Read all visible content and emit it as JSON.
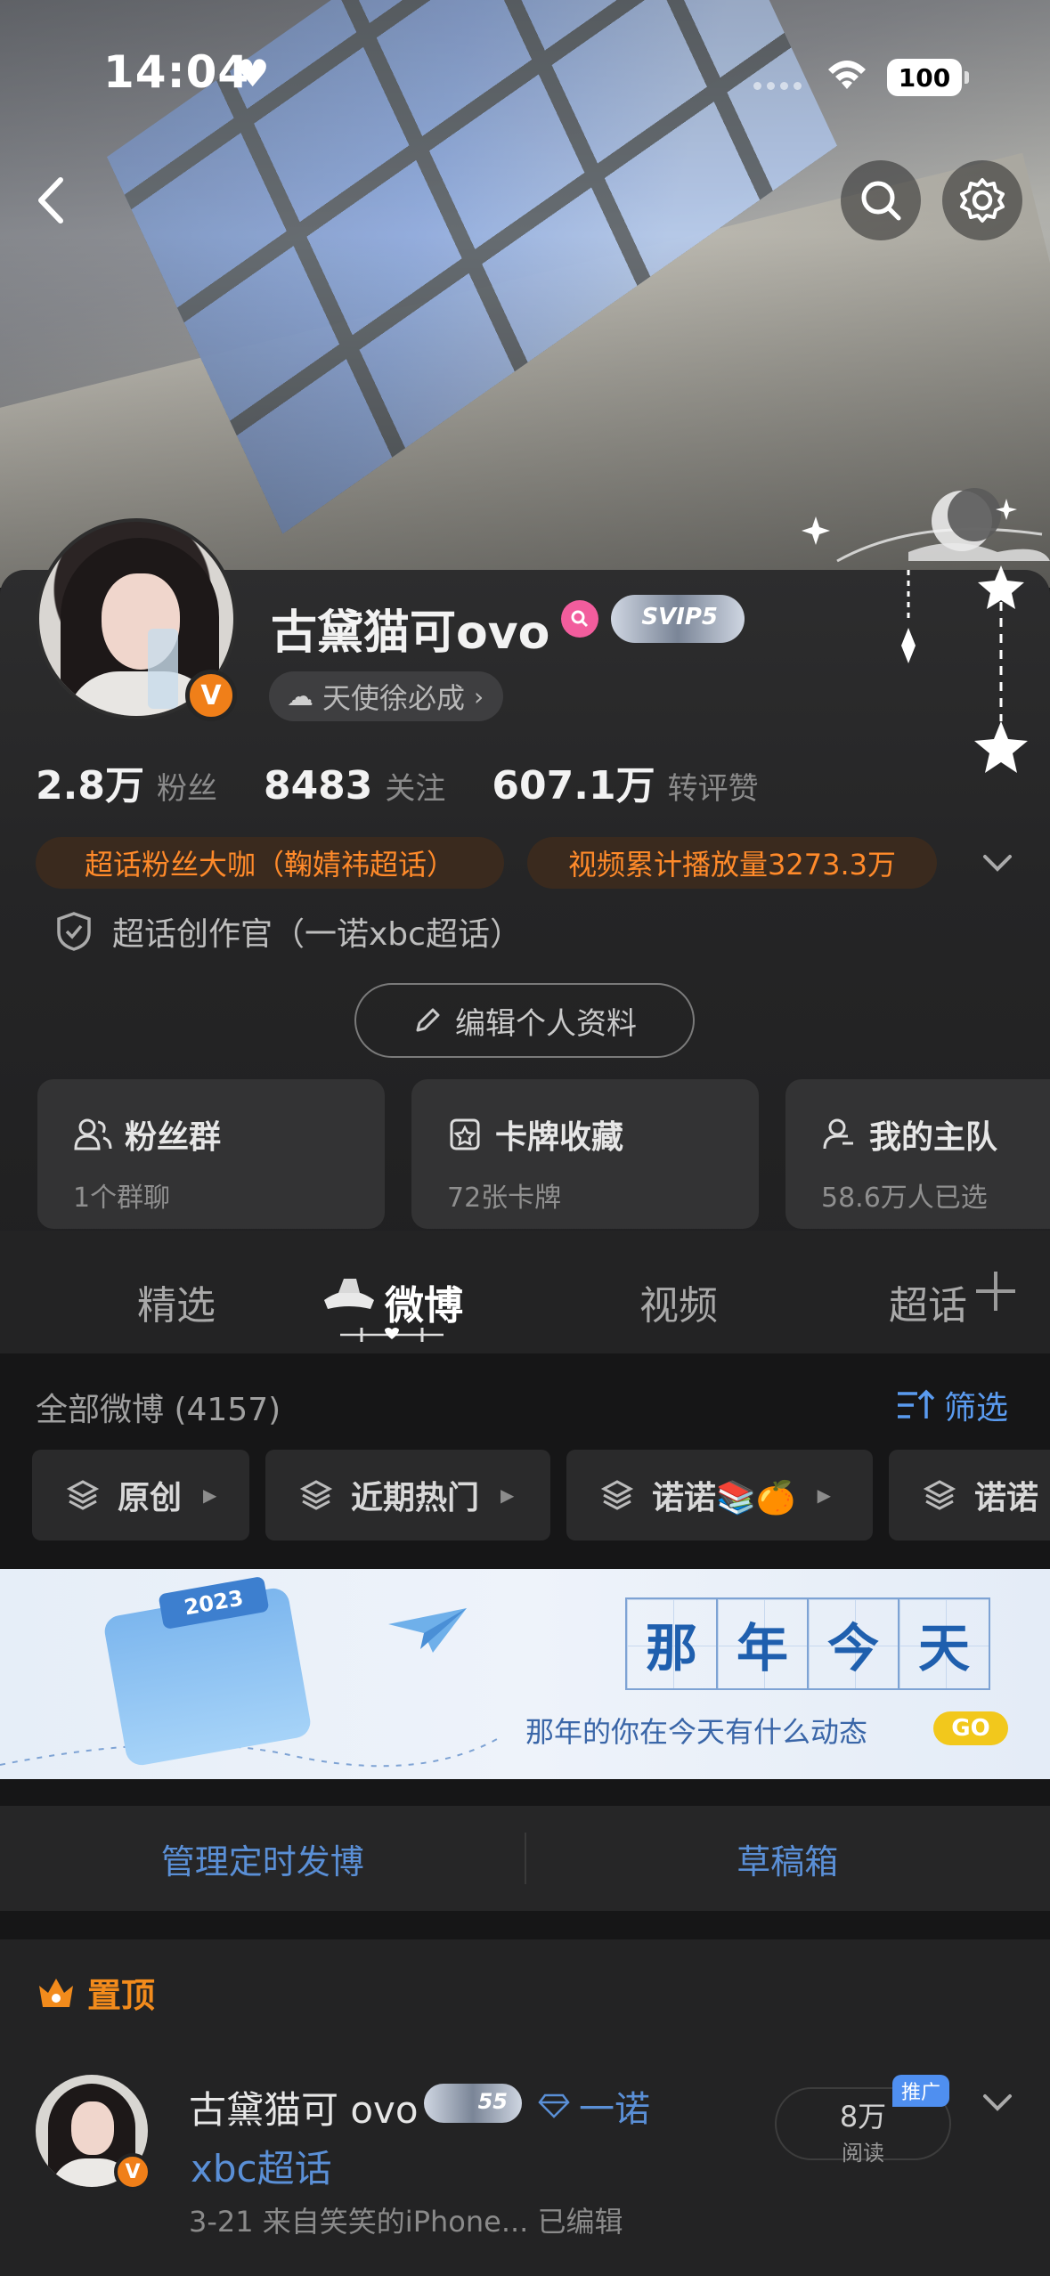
{
  "status_bar": {
    "time": "14:04",
    "battery": "100"
  },
  "header": {
    "back_icon": "chevron-left-icon",
    "search_icon": "search-icon",
    "settings_icon": "gear-icon"
  },
  "profile": {
    "username": "古黛猫可ovo",
    "level_badge_text": "SVIP5",
    "verified_badge": "V",
    "angel_chip": "天使徐必成",
    "stats": [
      {
        "num": "2.8万",
        "label": "粉丝"
      },
      {
        "num": "8483",
        "label": "关注"
      },
      {
        "num": "607.1万",
        "label": "转评赞"
      }
    ],
    "tags": [
      "超话粉丝大咖（鞠婧祎超话）",
      "视频累计播放量3273.3万"
    ],
    "creator": "超话创作官（一诺xbc超话）",
    "edit_button": "编辑个人资料",
    "cards": [
      {
        "title": "粉丝群",
        "sub": "1个群聊"
      },
      {
        "title": "卡牌收藏",
        "sub": "72张卡牌"
      },
      {
        "title": "我的主队",
        "sub": "58.6万人已选"
      }
    ]
  },
  "tabs": {
    "items": [
      "精选",
      "微博",
      "视频",
      "超话"
    ],
    "active": "微博"
  },
  "feed": {
    "header": "全部微博 (4157)",
    "filter_label": "筛选",
    "chips": [
      "原创",
      "近期热门",
      "诺诺📚🍊",
      "诺诺"
    ],
    "banner": {
      "calendar_year": "2023",
      "title_chars": [
        "那",
        "年",
        "今",
        "天"
      ],
      "tagline": "那年的你在今天有什么动态",
      "go": "GO"
    },
    "actions": [
      "管理定时发博",
      "草稿箱"
    ],
    "pinned_label": "置顶",
    "post": {
      "author": "古黛猫可 ovo",
      "level_badge_text": "55",
      "topic_line1": "一诺",
      "topic_line2": "xbc超话",
      "meta": "3-21  来自笑笑的iPhone...  已编辑",
      "reads_num": "8万",
      "reads_label": "阅读",
      "promo": "推广"
    }
  },
  "colors": {
    "accent_orange": "#ff8a2a",
    "link_blue": "#5a8fd6",
    "background": "#1e1e1e"
  }
}
